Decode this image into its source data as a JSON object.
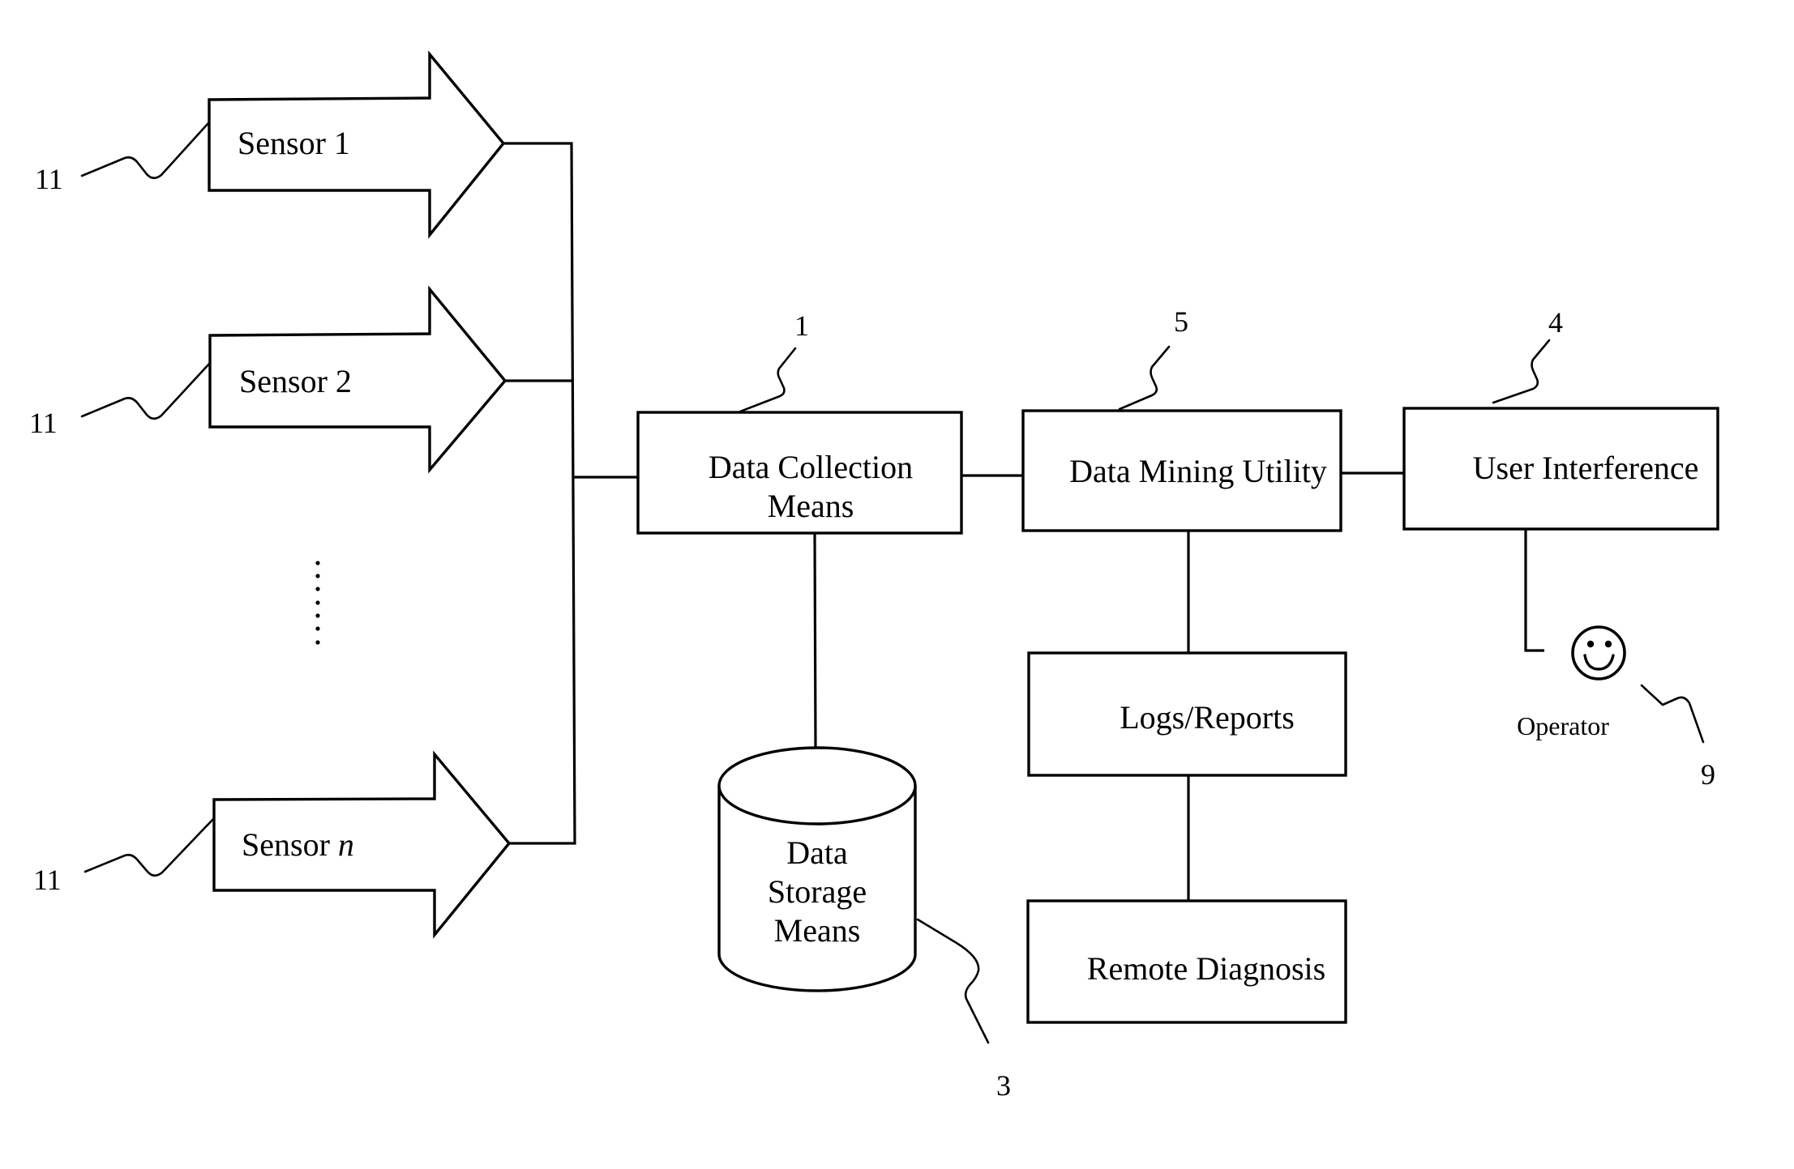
{
  "figure": {
    "background_color": "#ffffff",
    "line_color": "#000000"
  },
  "sensors": [
    {
      "label_prefix": "Sensor ",
      "label_index": "1",
      "index_italic": false,
      "ref": "11"
    },
    {
      "label_prefix": "Sensor ",
      "label_index": "2",
      "index_italic": false,
      "ref": "11"
    },
    {
      "label_prefix": "Sensor ",
      "label_index": "n",
      "index_italic": true,
      "ref": "11"
    }
  ],
  "ellipsis": "vertical-dots",
  "blocks": {
    "data_collection": {
      "lines": [
        "Data Collection",
        "Means"
      ],
      "ref": "1"
    },
    "data_mining": {
      "lines": [
        "Data Mining Utility"
      ],
      "ref": "5"
    },
    "user_interface": {
      "lines": [
        "User Interference"
      ],
      "ref": "4"
    },
    "logs_reports": {
      "lines": [
        "Logs/Reports"
      ]
    },
    "remote_diagnosis": {
      "lines": [
        "Remote Diagnosis"
      ]
    },
    "data_storage": {
      "lines": [
        "Data",
        "Storage",
        "Means"
      ],
      "ref": "3",
      "shape": "cylinder"
    }
  },
  "operator": {
    "label": "Operator",
    "icon": "smiley-face-icon",
    "ref": "9"
  },
  "connections": [
    [
      "sensor-1",
      "sensor-bus"
    ],
    [
      "sensor-2",
      "sensor-bus"
    ],
    [
      "sensor-n",
      "sensor-bus"
    ],
    [
      "sensor-bus",
      "data_collection"
    ],
    [
      "data_collection",
      "data_mining"
    ],
    [
      "data_collection",
      "data_storage"
    ],
    [
      "data_mining",
      "user_interface"
    ],
    [
      "data_mining",
      "logs_reports"
    ],
    [
      "logs_reports",
      "remote_diagnosis"
    ],
    [
      "user_interface",
      "operator"
    ]
  ]
}
